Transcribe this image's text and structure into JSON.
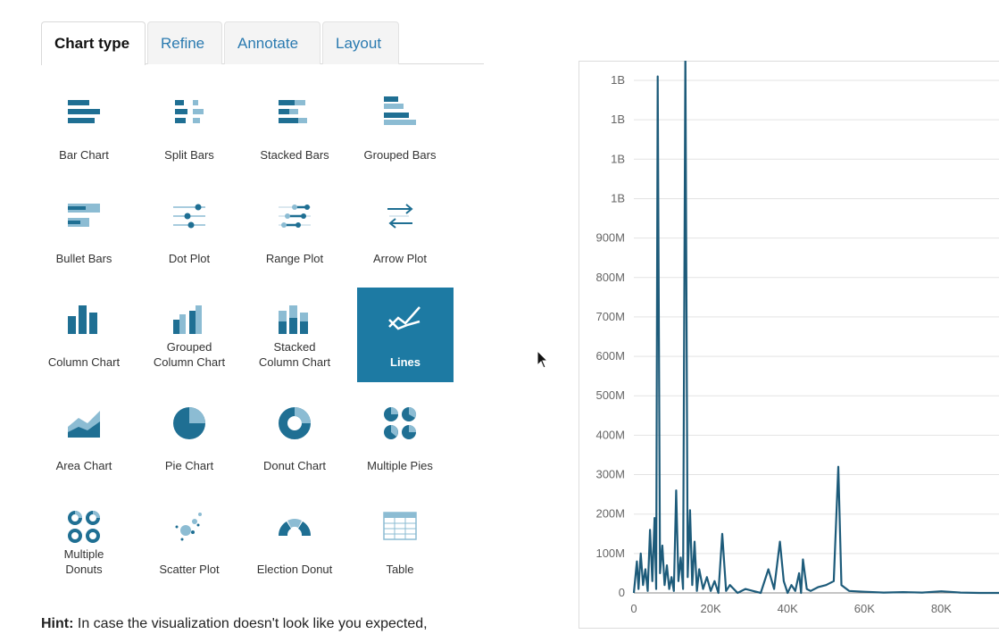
{
  "tabs": [
    "Chart type",
    "Refine",
    "Annotate",
    "Layout"
  ],
  "active_tab": "Chart type",
  "chart_types": [
    {
      "label": "Bar Chart",
      "icon": "bar-chart-icon"
    },
    {
      "label": "Split Bars",
      "icon": "split-bars-icon"
    },
    {
      "label": "Stacked Bars",
      "icon": "stacked-bars-icon"
    },
    {
      "label": "Grouped Bars",
      "icon": "grouped-bars-icon"
    },
    {
      "label": "Bullet Bars",
      "icon": "bullet-bars-icon"
    },
    {
      "label": "Dot Plot",
      "icon": "dot-plot-icon"
    },
    {
      "label": "Range Plot",
      "icon": "range-plot-icon"
    },
    {
      "label": "Arrow Plot",
      "icon": "arrow-plot-icon"
    },
    {
      "label": "Column Chart",
      "icon": "column-chart-icon"
    },
    {
      "label": "Grouped\nColumn Chart",
      "icon": "grouped-column-chart-icon"
    },
    {
      "label": "Stacked\nColumn Chart",
      "icon": "stacked-column-chart-icon"
    },
    {
      "label": "Lines",
      "icon": "lines-icon",
      "selected": true
    },
    {
      "label": "Area Chart",
      "icon": "area-chart-icon"
    },
    {
      "label": "Pie Chart",
      "icon": "pie-chart-icon"
    },
    {
      "label": "Donut Chart",
      "icon": "donut-chart-icon"
    },
    {
      "label": "Multiple Pies",
      "icon": "multiple-pies-icon"
    },
    {
      "label": "Multiple\nDonuts",
      "icon": "multiple-donuts-icon"
    },
    {
      "label": "Scatter Plot",
      "icon": "scatter-plot-icon"
    },
    {
      "label": "Election Donut",
      "icon": "election-donut-icon"
    },
    {
      "label": "Table",
      "icon": "table-icon"
    }
  ],
  "hint": {
    "bold": "Hint:",
    "text": " In case the visualization doesn't look like you expected,"
  },
  "colors": {
    "accent": "#1d7aa3",
    "icon": "#1f6f93",
    "icon_light": "#8cbcd3",
    "line": "#1d5b7a"
  },
  "chart_data": {
    "type": "line",
    "title": "",
    "xlabel": "",
    "ylabel": "",
    "xlim": [
      0,
      95000
    ],
    "ylim": [
      0,
      1300000000
    ],
    "x_ticks": [
      {
        "v": 0,
        "label": "0"
      },
      {
        "v": 20000,
        "label": "20K"
      },
      {
        "v": 40000,
        "label": "40K"
      },
      {
        "v": 60000,
        "label": "60K"
      },
      {
        "v": 80000,
        "label": "80K"
      }
    ],
    "y_ticks": [
      {
        "v": 0,
        "label": "0"
      },
      {
        "v": 100000000,
        "label": "100M"
      },
      {
        "v": 200000000,
        "label": "200M"
      },
      {
        "v": 300000000,
        "label": "300M"
      },
      {
        "v": 400000000,
        "label": "400M"
      },
      {
        "v": 500000000,
        "label": "500M"
      },
      {
        "v": 600000000,
        "label": "600M"
      },
      {
        "v": 700000000,
        "label": "700M"
      },
      {
        "v": 800000000,
        "label": "800M"
      },
      {
        "v": 900000000,
        "label": "900M"
      },
      {
        "v": 1000000000,
        "label": "1B"
      },
      {
        "v": 1100000000,
        "label": "1B"
      },
      {
        "v": 1200000000,
        "label": "1B"
      },
      {
        "v": 1300000000,
        "label": "1B"
      }
    ],
    "grid": true,
    "legend": "none",
    "series": [
      {
        "x": [
          0,
          800,
          1200,
          1800,
          2400,
          3000,
          3600,
          4200,
          4800,
          5400,
          5800,
          6200,
          6800,
          7400,
          8000,
          8600,
          9200,
          9800,
          10400,
          11000,
          11600,
          12200,
          12800,
          13400,
          14000,
          14600,
          15200,
          15800,
          16400,
          17000,
          18000,
          19000,
          20000,
          21000,
          22000,
          23000,
          24000,
          25000,
          27000,
          29000,
          31000,
          33000,
          35000,
          36500,
          38000,
          39000,
          40000,
          41000,
          42000,
          43000,
          43500,
          44000,
          45000,
          46000,
          48000,
          50000,
          52000,
          53200,
          54000,
          56000,
          60000,
          65000,
          70000,
          75000,
          80000,
          85000,
          90000,
          95000
        ],
        "y": [
          0,
          80000000,
          10000000,
          100000000,
          20000000,
          60000000,
          5000000,
          160000000,
          30000000,
          190000000,
          10000000,
          1310000000,
          50000000,
          120000000,
          20000000,
          70000000,
          10000000,
          40000000,
          5000000,
          260000000,
          30000000,
          90000000,
          10000000,
          1370000000,
          40000000,
          210000000,
          20000000,
          130000000,
          5000000,
          60000000,
          10000000,
          40000000,
          5000000,
          30000000,
          0,
          150000000,
          5000000,
          20000000,
          0,
          10000000,
          5000000,
          0,
          60000000,
          10000000,
          130000000,
          30000000,
          0,
          20000000,
          5000000,
          50000000,
          0,
          85000000,
          10000000,
          5000000,
          15000000,
          20000000,
          30000000,
          320000000,
          20000000,
          5000000,
          3000000,
          1000000,
          2000000,
          1000000,
          4000000,
          1000000,
          0,
          0
        ]
      }
    ]
  }
}
